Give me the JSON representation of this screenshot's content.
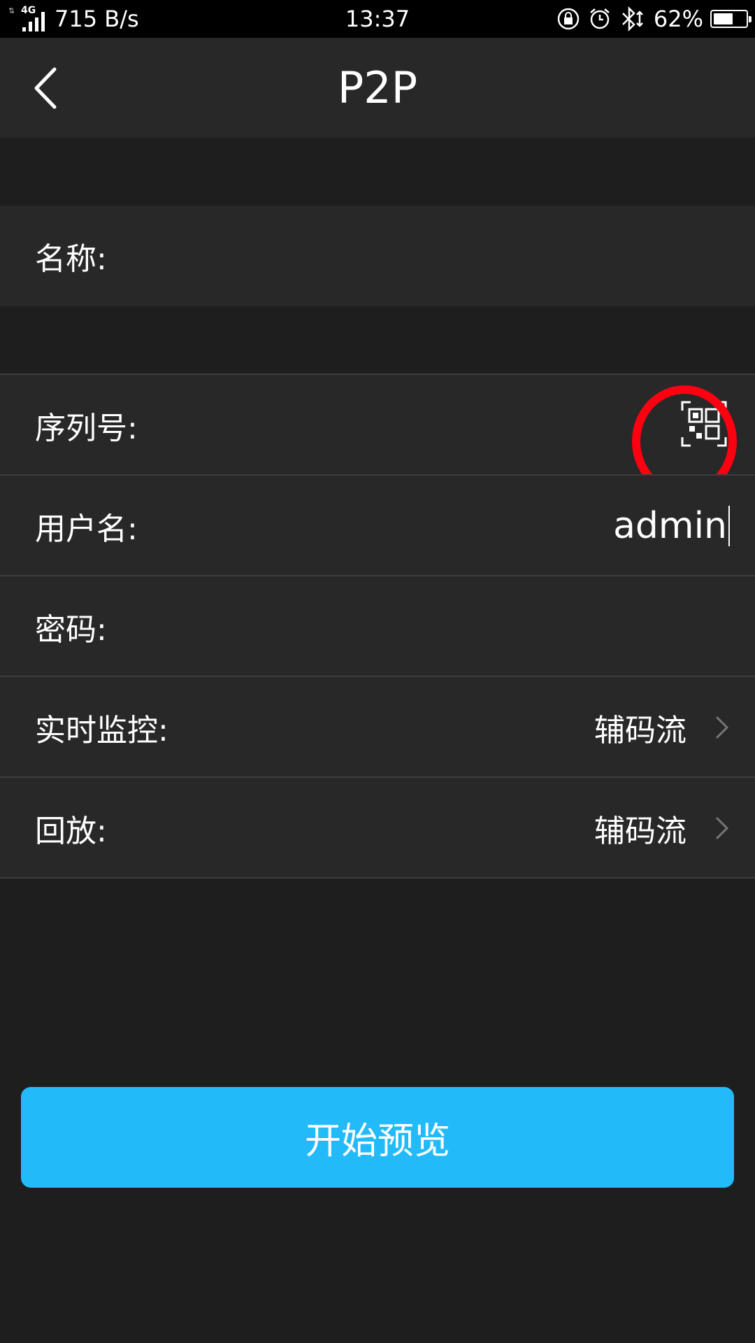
{
  "status_bar": {
    "network_type": "4G",
    "net_speed": "715 B/s",
    "time": "13:37",
    "battery": "62%",
    "battery_level": 0.62
  },
  "header": {
    "title": "P2P"
  },
  "form": {
    "name_label": "名称:",
    "serial_label": "序列号:",
    "username_label": "用户名:",
    "username_value": "admin",
    "password_label": "密码:",
    "live_label": "实时监控:",
    "live_value": "辅码流",
    "playback_label": "回放:",
    "playback_value": "辅码流"
  },
  "actions": {
    "start_preview": "开始预览"
  },
  "colors": {
    "accent": "#23baf9",
    "annotation": "#ff0011"
  }
}
